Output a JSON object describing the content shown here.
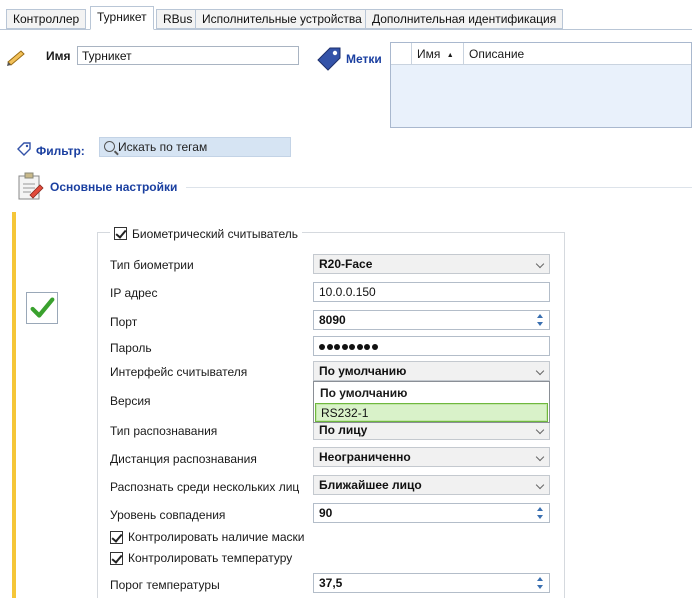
{
  "tabs": [
    {
      "label": "Контроллер",
      "active": false
    },
    {
      "label": "Турникет",
      "active": true
    },
    {
      "label": "RBus",
      "active": false
    },
    {
      "label": "Исполнительные устройства",
      "active": false
    },
    {
      "label": "Дополнительная идентификация",
      "active": false
    }
  ],
  "name": {
    "label": "Имя",
    "value": "Турникет"
  },
  "tags": {
    "label": "Метки",
    "columns": [
      "Имя",
      "Описание"
    ]
  },
  "filter": {
    "label": "Фильтр:",
    "placeholder": "Искать по тегам"
  },
  "settings": {
    "title": "Основные настройки"
  },
  "biometric": {
    "enabled_label": "Биометрический считыватель",
    "enabled": true,
    "rows": {
      "biometry_type": {
        "label": "Тип биометрии",
        "value": "R20-Face"
      },
      "ip": {
        "label": "IP адрес",
        "value": "10.0.0.150"
      },
      "port": {
        "label": "Порт",
        "value": "8090"
      },
      "password": {
        "label": "Пароль"
      },
      "interface": {
        "label": "Интерфейс считывателя",
        "value": "По умолчанию"
      },
      "version": {
        "label": "Версия"
      },
      "recognition_type": {
        "label": "Тип распознавания",
        "value": "По лицу"
      },
      "distance": {
        "label": "Дистанция распознавания",
        "value": "Неограниченно"
      },
      "multi_face": {
        "label": "Распознать среди нескольких лиц",
        "value": "Ближайшее лицо"
      },
      "match_level": {
        "label": "Уровень совпадения",
        "value": "90"
      },
      "temp_threshold": {
        "label": "Порог температуры",
        "value": "37,5"
      }
    },
    "mask_check": {
      "label": "Контролировать наличие маски",
      "checked": true
    },
    "temp_check": {
      "label": "Контролировать температуру",
      "checked": true
    },
    "interface_options": [
      "По умолчанию",
      "RS232-1"
    ]
  },
  "colors": {
    "accent_bar": "#f5c638",
    "link_blue": "#1a3fa0",
    "selection_green": "#d9f2c9"
  }
}
